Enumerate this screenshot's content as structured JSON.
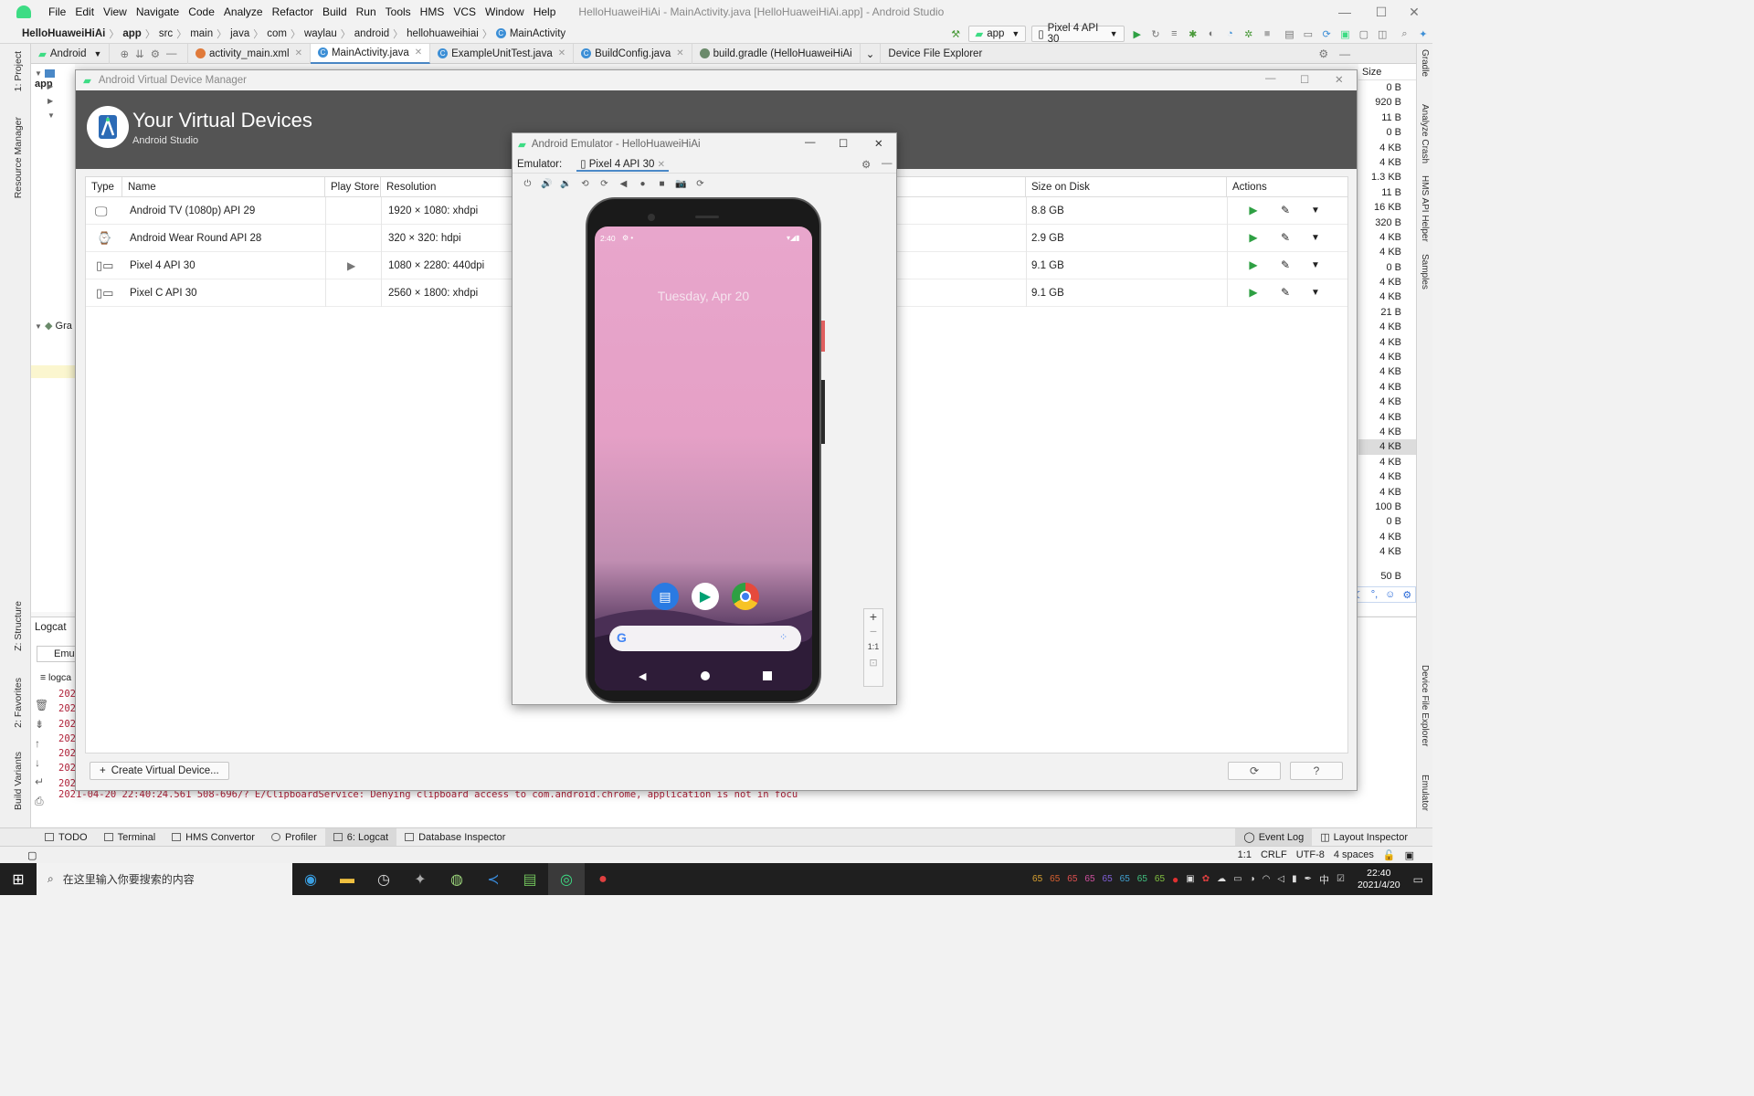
{
  "menubar": {
    "items": [
      "File",
      "Edit",
      "View",
      "Navigate",
      "Code",
      "Analyze",
      "Refactor",
      "Build",
      "Run",
      "Tools",
      "HMS",
      "VCS",
      "Window",
      "Help"
    ],
    "window_title": "HelloHuaweiHiAi - MainActivity.java [HelloHuaweiHiAi.app] - Android Studio"
  },
  "navbar": {
    "breadcrumbs": [
      "HelloHuaweiHiAi",
      "app",
      "src",
      "main",
      "java",
      "com",
      "waylau",
      "android",
      "hellohuaweihiai",
      "MainActivity"
    ],
    "run_config": "app",
    "device": "Pixel 4 API 30"
  },
  "project_panel": {
    "view": "Android",
    "root": "app",
    "gradle_label": "Gra"
  },
  "editor_tabs": [
    {
      "label": "activity_main.xml",
      "active": false
    },
    {
      "label": "MainActivity.java",
      "active": true
    },
    {
      "label": "ExampleUnitTest.java",
      "active": false
    },
    {
      "label": "BuildConfig.java",
      "active": false
    },
    {
      "label": "build.gradle (HelloHuaweiHiAi",
      "active": false
    }
  ],
  "device_file_explorer": {
    "title": "Device File Explorer",
    "size_header": "Size",
    "sizes": [
      "0 B",
      "920 B",
      "11 B",
      "0 B",
      "4 KB",
      "4 KB",
      "1.3 KB",
      "11 B",
      "16 KB",
      "320 B",
      "4 KB",
      "4 KB",
      "0 B",
      "4 KB",
      "4 KB",
      "21 B",
      "4 KB",
      "4 KB",
      "4 KB",
      "4 KB",
      "4 KB",
      "4 KB",
      "4 KB",
      "4 KB",
      "4 KB",
      "4 KB",
      "4 KB",
      "4 KB",
      "100 B",
      "0 B",
      "4 KB",
      "4 KB"
    ],
    "last_size": "50 B"
  },
  "left_tool_windows": [
    "1: Project",
    "Resource Manager",
    "Z: Structure",
    "2: Favorites",
    "Build Variants"
  ],
  "right_tool_windows": [
    "Gradle",
    "Analyze Crash",
    "HMS API Helper",
    "Samples",
    "Device File Explorer",
    "Emulator"
  ],
  "logcat": {
    "title": "Logcat",
    "device": "Emu",
    "filter": "logca",
    "timestamps": [
      "202",
      "202",
      "202",
      "202",
      "202",
      "202",
      "202"
    ],
    "error_line": "2021-04-20 22:40:24.561 508-696/? E/ClipboardService: Denying clipboard access to com.android.chrome, application is not in focu"
  },
  "bottom_tabs": [
    {
      "label": "TODO",
      "active": false
    },
    {
      "label": "Terminal",
      "active": false
    },
    {
      "label": "HMS Convertor",
      "active": false
    },
    {
      "label": "Profiler",
      "active": false
    },
    {
      "label": "6: Logcat",
      "active": true
    },
    {
      "label": "Database Inspector",
      "active": false
    }
  ],
  "bottom_right_tabs": [
    "Event Log",
    "Layout Inspector"
  ],
  "status": {
    "position": "1:1",
    "line_sep": "CRLF",
    "encoding": "UTF-8",
    "indent": "4 spaces"
  },
  "avd": {
    "window_title": "Android Virtual Device Manager",
    "heading": "Your Virtual Devices",
    "subheading": "Android Studio",
    "columns": [
      "Type",
      "Name",
      "Play Store",
      "Resolution",
      "Size on Disk",
      "Actions"
    ],
    "devices": [
      {
        "name": "Android TV (1080p) API 29",
        "resolution": "1920 × 1080: xhdpi",
        "size": "8.8 GB",
        "type_icon": "tv-icon",
        "play_store": false
      },
      {
        "name": "Android Wear Round API 28",
        "resolution": "320 × 320: hdpi",
        "size": "2.9 GB",
        "type_icon": "watch-icon",
        "play_store": false
      },
      {
        "name": "Pixel 4 API 30",
        "resolution": "1080 × 2280: 440dpi",
        "size": "9.1 GB",
        "type_icon": "phone-tablet-icon",
        "play_store": true
      },
      {
        "name": "Pixel C API 30",
        "resolution": "2560 × 1800: xhdpi",
        "size": "9.1 GB",
        "type_icon": "phone-tablet-icon",
        "play_store": false
      }
    ],
    "create_button": "Create Virtual Device...",
    "help_button": "?"
  },
  "emulator": {
    "window_title": "Android Emulator - HelloHuaweiHiAi",
    "label": "Emulator:",
    "tab": "Pixel 4 API 30",
    "phone_time": "2:40",
    "phone_date": "Tuesday, Apr 20",
    "zoom_ratio": "1:1"
  },
  "taskbar": {
    "search_placeholder": "在这里输入你要搜索的内容",
    "time": "22:40",
    "date": "2021/4/20",
    "ime": "中",
    "tray_numbers": [
      "65",
      "65",
      "65",
      "65",
      "65",
      "65",
      "65",
      "65"
    ]
  },
  "colors": {
    "accent": "#4a88c7",
    "android_green": "#3ddc84",
    "play_green": "#2ea043",
    "avd_header": "#545454",
    "error_red": "#b2223a"
  }
}
